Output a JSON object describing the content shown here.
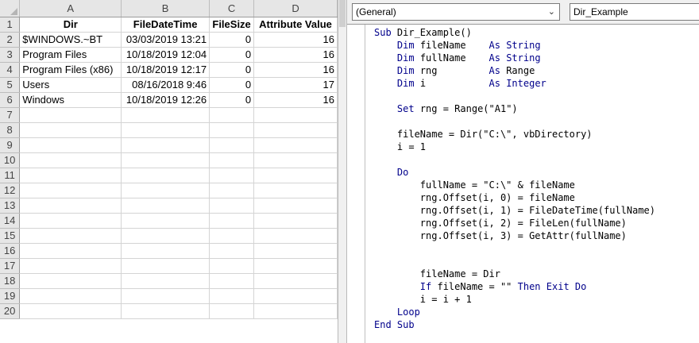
{
  "sheet": {
    "columns": [
      "A",
      "B",
      "C",
      "D"
    ],
    "rows": [
      [
        "Dir",
        "FileDateTime",
        "FileSize",
        "Attribute Value"
      ],
      [
        "$WINDOWS.~BT",
        "03/03/2019 13:21",
        "0",
        "16"
      ],
      [
        "Program Files",
        "10/18/2019 12:04",
        "0",
        "16"
      ],
      [
        "Program Files (x86)",
        "10/18/2019 12:17",
        "0",
        "16"
      ],
      [
        "Users",
        "08/16/2018 9:46",
        "0",
        "17"
      ],
      [
        "Windows",
        "10/18/2019 12:26",
        "0",
        "16"
      ],
      [
        "",
        "",
        "",
        ""
      ],
      [
        "",
        "",
        "",
        ""
      ],
      [
        "",
        "",
        "",
        ""
      ],
      [
        "",
        "",
        "",
        ""
      ],
      [
        "",
        "",
        "",
        ""
      ],
      [
        "",
        "",
        "",
        ""
      ],
      [
        "",
        "",
        "",
        ""
      ],
      [
        "",
        "",
        "",
        ""
      ],
      [
        "",
        "",
        "",
        ""
      ],
      [
        "",
        "",
        "",
        ""
      ],
      [
        "",
        "",
        "",
        ""
      ],
      [
        "",
        "",
        "",
        ""
      ],
      [
        "",
        "",
        "",
        ""
      ],
      [
        "",
        "",
        "",
        ""
      ]
    ],
    "row_numbers": [
      "1",
      "2",
      "3",
      "4",
      "5",
      "6",
      "7",
      "8",
      "9",
      "10",
      "11",
      "12",
      "13",
      "14",
      "15",
      "16",
      "17",
      "18",
      "19",
      "20"
    ]
  },
  "editor": {
    "object_combo": "(General)",
    "procedure_combo": "Dir_Example",
    "dropdown_icon": "chevron-down-icon",
    "keyword_color": "#00008b",
    "code_lines": [
      "Sub Dir_Example()",
      "    Dim fileName    As String",
      "    Dim fullName    As String",
      "    Dim rng         As Range",
      "    Dim i           As Integer",
      "",
      "    Set rng = Range(\"A1\")",
      "",
      "    fileName = Dir(\"C:\\\", vbDirectory)",
      "    i = 1",
      "",
      "    Do",
      "        fullName = \"C:\\\" & fileName",
      "        rng.Offset(i, 0) = fileName",
      "        rng.Offset(i, 1) = FileDateTime(fullName)",
      "        rng.Offset(i, 2) = FileLen(fullName)",
      "        rng.Offset(i, 3) = GetAttr(fullName)",
      "",
      "",
      "        fileName = Dir",
      "        If fileName = \"\" Then Exit Do",
      "        i = i + 1",
      "    Loop",
      "End Sub"
    ]
  }
}
